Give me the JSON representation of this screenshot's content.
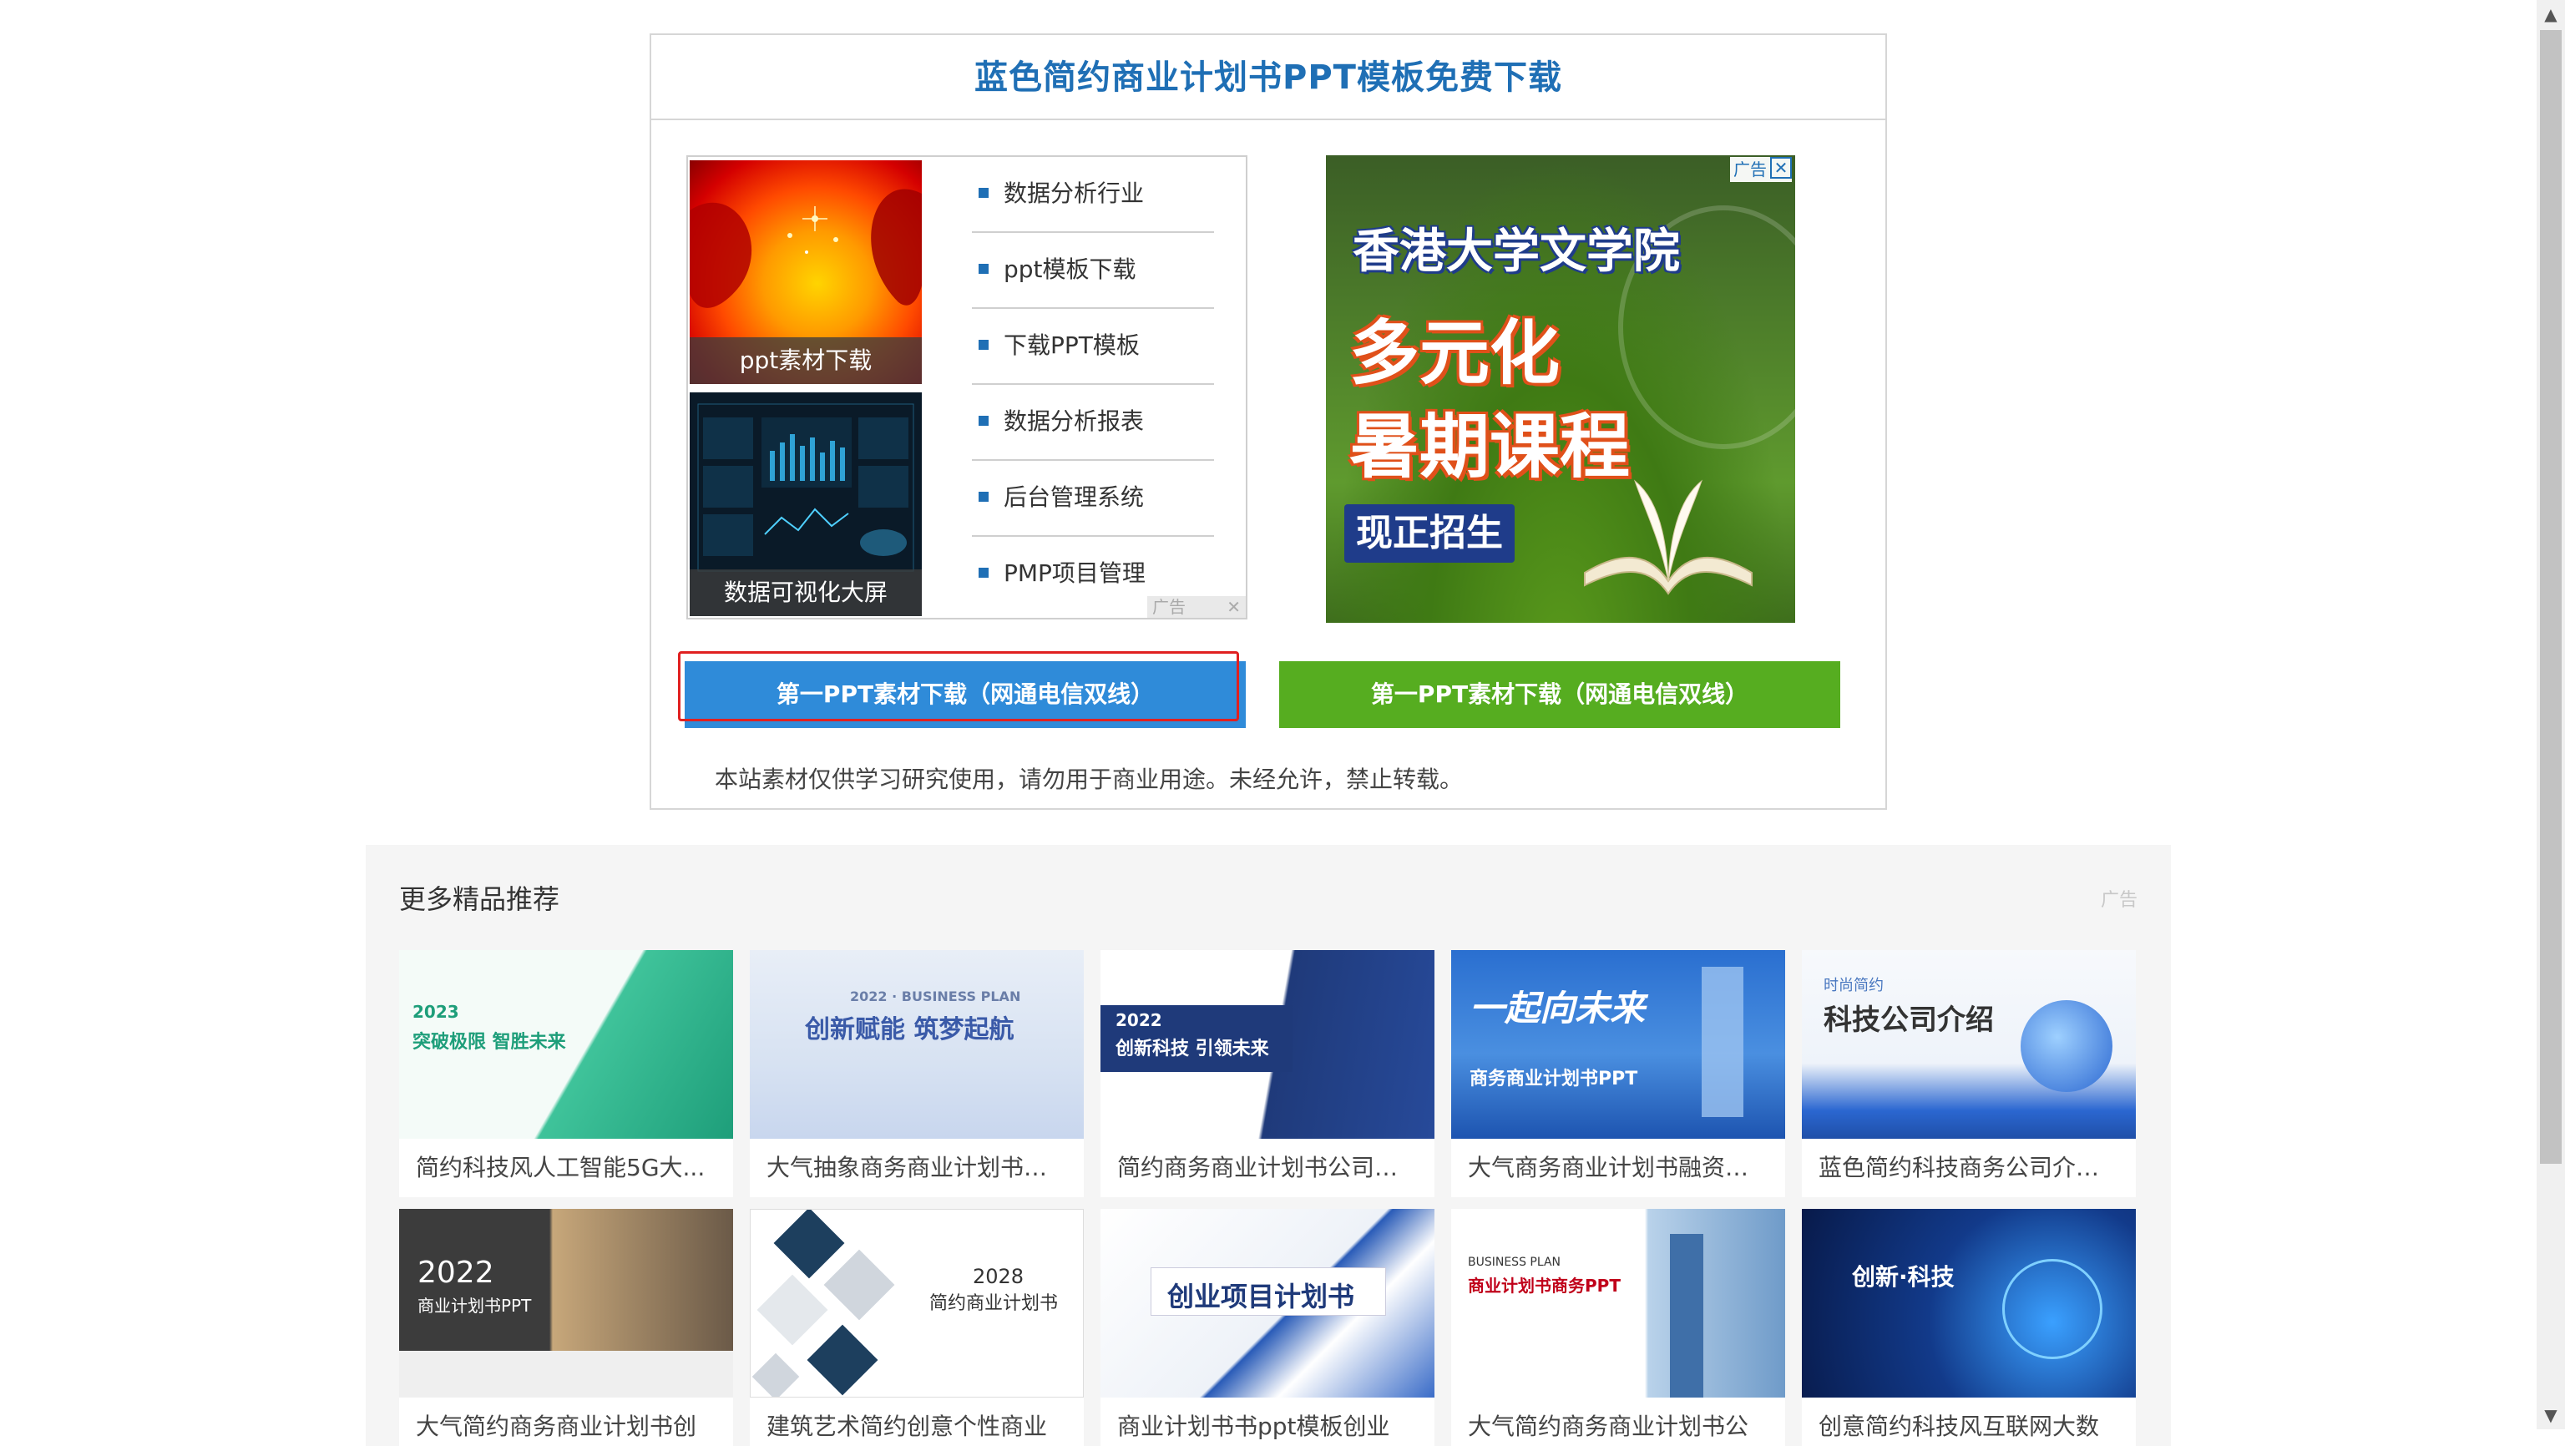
{
  "download": {
    "title": "蓝色简约商业计划书PPT模板免费下载",
    "notice": "本站素材仅供学习研究使用，请勿用于商业用途。未经允许，禁止转载。",
    "btn_blue": "第一PPT素材下载（网通电信双线）",
    "btn_green": "第一PPT素材下载（网通电信双线）"
  },
  "ad_left": {
    "thumbs": [
      "ppt素材下载",
      "数据可视化大屏"
    ],
    "links": [
      "数据分析行业",
      "ppt模板下载",
      "下载PPT模板",
      "数据分析报表",
      "后台管理系统",
      "PMP项目管理"
    ],
    "badge": "广告",
    "badge_close": "✕"
  },
  "ad_right": {
    "line1": "香港大学文学院",
    "line2": "多元化",
    "line3": "暑期课程",
    "cta": "现正招生",
    "badge": "广告",
    "close": "✕"
  },
  "recommend": {
    "title": "更多精品推荐",
    "ad_label": "广告",
    "cards": [
      {
        "caption": "简约科技风人工智能5G大...",
        "img_title": "突破极限 智胜未来",
        "img_year": "2023"
      },
      {
        "caption": "大气抽象商务商业计划书项...",
        "img_title": "创新赋能 筑梦起航",
        "img_year": "2022 · BUSINESS PLAN"
      },
      {
        "caption": "简约商务商业计划书公司介...",
        "img_title": "创新科技 引领未来",
        "img_year": "2022"
      },
      {
        "caption": "大气商务商业计划书融资计...",
        "img_title": "一起向未来",
        "img_year": "商务商业计划书PPT"
      },
      {
        "caption": "蓝色简约科技商务公司介绍...",
        "img_title": "科技公司介绍",
        "img_year": "时尚简约"
      },
      {
        "caption": "大气简约商务商业计划书创",
        "img_title": "商业计划书PPT",
        "img_year": "2022"
      },
      {
        "caption": "建筑艺术简约创意个性商业",
        "img_title": "简约商业计划书",
        "img_year": "2028"
      },
      {
        "caption": "商业计划书书ppt模板创业",
        "img_title": "创业项目计划书",
        "img_year": ""
      },
      {
        "caption": "大气简约商务商业计划书公",
        "img_title": "商业计划书商务PPT",
        "img_year": "BUSINESS PLAN"
      },
      {
        "caption": "创意简约科技风互联网大数",
        "img_title": "创新·科技",
        "img_year": ""
      }
    ]
  },
  "scrollbar": {
    "up": "▲",
    "down": "▼"
  }
}
